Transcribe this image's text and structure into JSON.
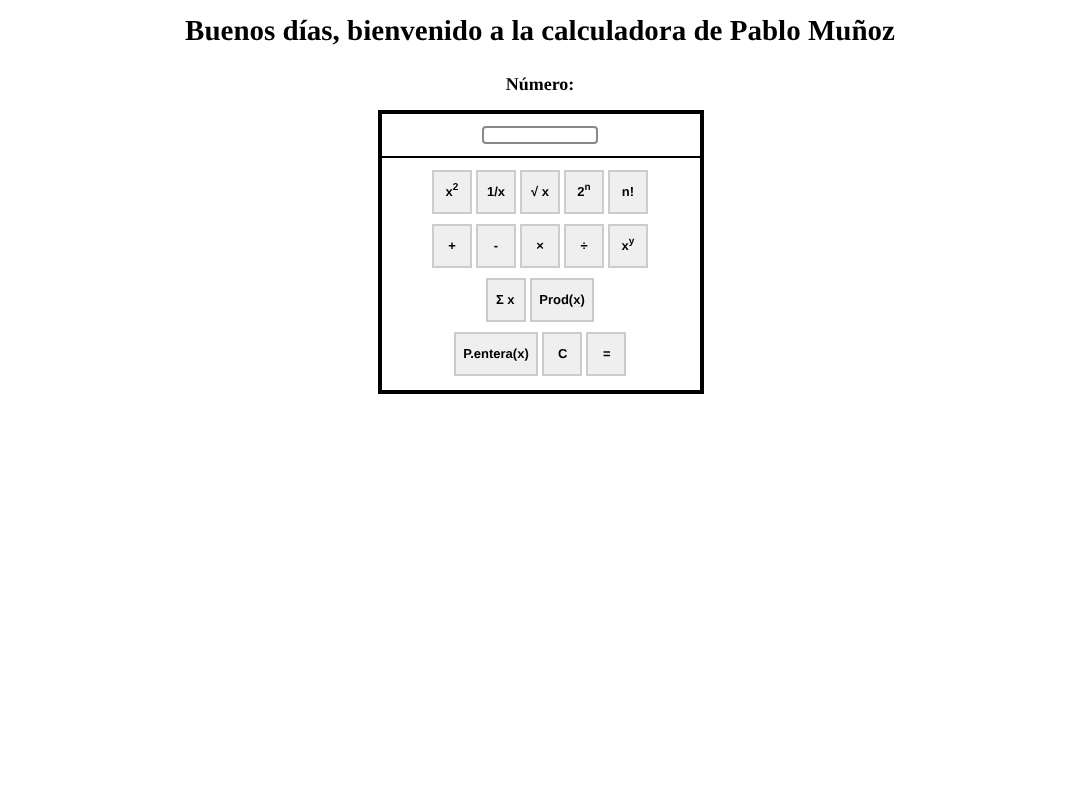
{
  "title": "Buenos días, bienvenido a la calculadora de Pablo Muñoz",
  "field_label": "Número:",
  "button_rows": [
    [
      "x$^{2}$",
      "1/x",
      "√ x",
      "2$^{n}$",
      "n!"
    ],
    [
      "+",
      "-",
      "×",
      "÷",
      "x$^{y}$"
    ],
    [
      "Σ x",
      "Prod(x)"
    ],
    [
      "P.entera(x)",
      "C",
      "="
    ]
  ]
}
